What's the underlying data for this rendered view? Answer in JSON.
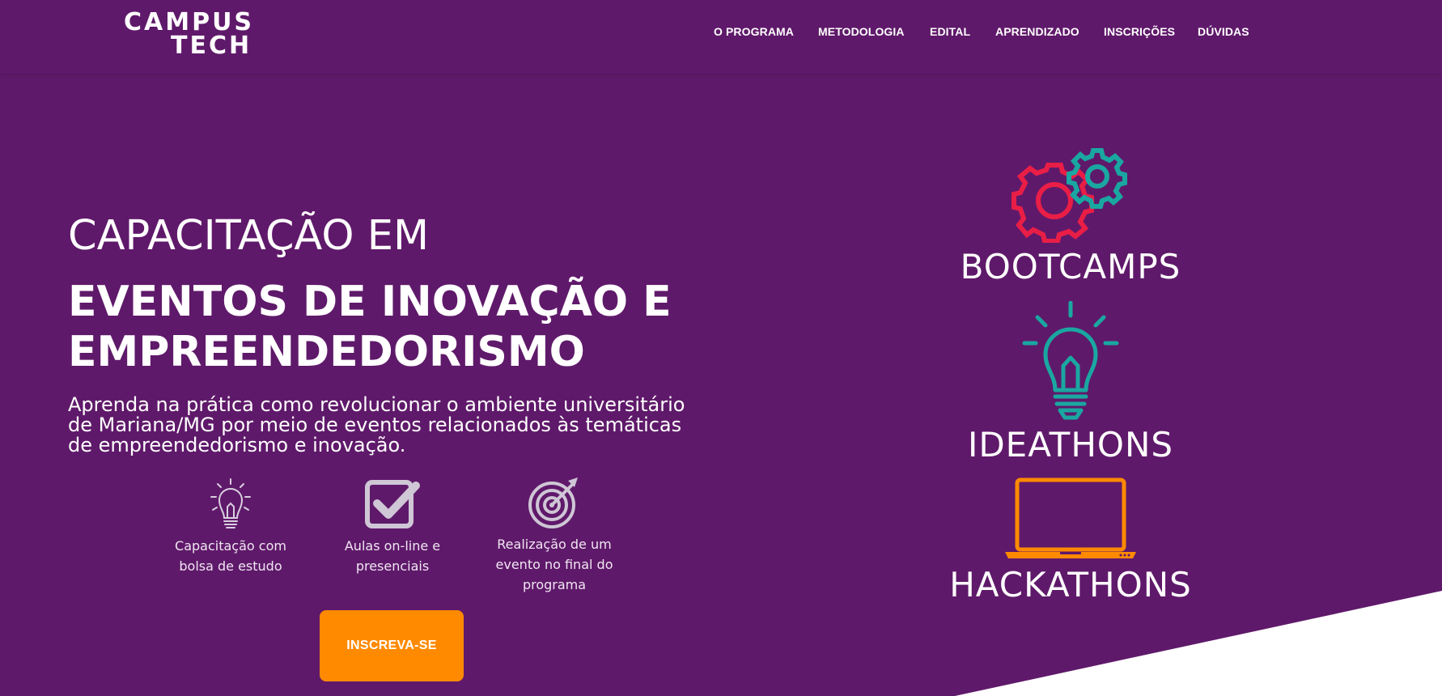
{
  "logo": {
    "line1": "CAMPUS",
    "line2": "TECH"
  },
  "nav": {
    "items": [
      "O PROGRAMA",
      "METODOLOGIA",
      "EDITAL",
      "APRENDIZADO",
      "INSCRIÇÕES",
      "DÚVIDAS"
    ]
  },
  "hero": {
    "pretitle": "CAPACITAÇÃO EM",
    "title_line1": "EVENTOS DE INOVAÇÃO E",
    "title_line2": "EMPREENDEDORISMO",
    "description": "Aprenda na prática como revolucionar o ambiente universitário de Mariana/MG por meio de eventos relacionados às temáticas de empreendedorismo e inovação."
  },
  "features": [
    {
      "icon": "lightbulb-icon",
      "line1": "Capacitação com",
      "line2": "bolsa de estudo"
    },
    {
      "icon": "checkbox-icon",
      "line1": "Aulas on-line e",
      "line2": "presenciais"
    },
    {
      "icon": "target-icon",
      "line1": "Realização de um",
      "line2": "evento no final do",
      "line3": "programa"
    }
  ],
  "cta": {
    "label": "INSCREVA-SE"
  },
  "categories": [
    {
      "icon": "gears-icon",
      "label": "BOOTCAMPS",
      "color": "#e91e46",
      "color2": "#1aa7a1"
    },
    {
      "icon": "lightbulb-icon",
      "label": "IDEATHONS",
      "color": "#1aa7a1"
    },
    {
      "icon": "laptop-icon",
      "label": "HACKATHONS",
      "color": "#ff8a00"
    }
  ],
  "colors": {
    "background": "#5f196a",
    "accent": "#ff8a00",
    "white": "#ffffff"
  }
}
